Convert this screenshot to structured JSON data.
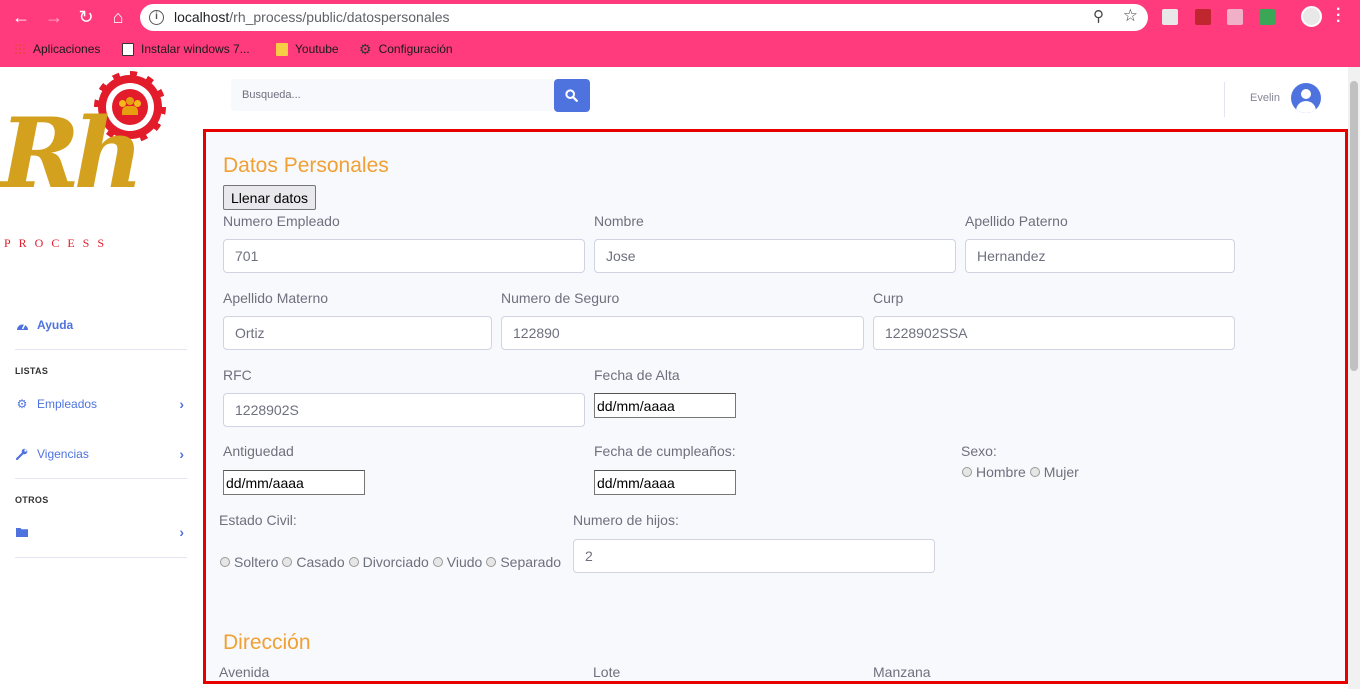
{
  "browser": {
    "url_host": "localhost",
    "url_path": "/rh_process/public/datospersonales",
    "bookmarks": [
      {
        "label": "Aplicaciones"
      },
      {
        "label": "Instalar windows 7..."
      },
      {
        "label": "Youtube"
      },
      {
        "label": "Configuración"
      }
    ],
    "colors": {
      "chrome": "#ff3b7e"
    }
  },
  "logo": {
    "brand": "Rh",
    "subtitle": "PROCESS"
  },
  "sidebar": {
    "items": [
      {
        "label": "Ayuda",
        "icon": "tachometer-icon"
      },
      {
        "label": "Empleados",
        "icon": "cog-icon"
      },
      {
        "label": "Vigencias",
        "icon": "wrench-icon"
      },
      {
        "label": "",
        "icon": "folder-icon"
      }
    ],
    "headings": [
      "LISTAS",
      "OTROS"
    ]
  },
  "topbar": {
    "search_placeholder": "Busqueda...",
    "user_name": "Evelin"
  },
  "form": {
    "title": "Datos Personales",
    "fill_button": "Llenar datos",
    "numero_empleado": {
      "label": "Numero Empleado",
      "value": "701"
    },
    "nombre": {
      "label": "Nombre",
      "value": "Jose"
    },
    "apellido_paterno": {
      "label": "Apellido Paterno",
      "value": "Hernandez"
    },
    "apellido_materno": {
      "label": "Apellido Materno",
      "value": "Ortiz"
    },
    "numero_seguro": {
      "label": "Numero de Seguro",
      "value": "122890"
    },
    "curp": {
      "label": "Curp",
      "value": "1228902SSA"
    },
    "rfc": {
      "label": "RFC",
      "value": "1228902S"
    },
    "fecha_alta": {
      "label": "Fecha de Alta",
      "value": "dd/mm/aaaa"
    },
    "antiguedad": {
      "label": "Antiguedad",
      "value": "dd/mm/aaaa"
    },
    "fecha_cumple": {
      "label": "Fecha de cumpleaños:",
      "value": "dd/mm/aaaa"
    },
    "sexo": {
      "label": "Sexo:",
      "options": [
        "Hombre",
        "Mujer"
      ]
    },
    "estado_civil": {
      "label": "Estado Civil:",
      "options": [
        "Soltero",
        "Casado",
        "Divorciado",
        "Viudo",
        "Separado"
      ]
    },
    "numero_hijos": {
      "label": "Numero de hijos:",
      "value": "2"
    }
  },
  "direccion": {
    "title": "Dirección",
    "labels": [
      "Avenida",
      "Lote",
      "Manzana"
    ]
  },
  "colors": {
    "accent": "#4e73df",
    "section_title": "#f0a035",
    "frame": "#e60000"
  }
}
